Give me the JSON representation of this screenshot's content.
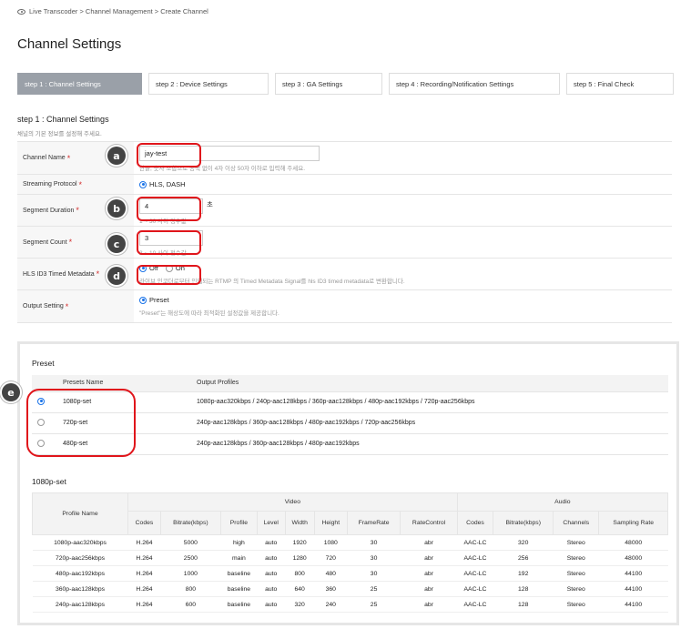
{
  "breadcrumb": "Live Transcoder > Channel Management > Create Channel",
  "page_title": "Channel Settings",
  "steps": [
    {
      "label": "step 1 : Channel Settings",
      "active": true
    },
    {
      "label": "step 2 : Device Settings"
    },
    {
      "label": "step 3 : GA Settings"
    },
    {
      "label": "step 4 : Recording/Notification Settings"
    },
    {
      "label": "step 5 : Final Check"
    }
  ],
  "section": {
    "title": "step 1 : Channel Settings",
    "subtitle": "채널의 기본 정보를 설정해 주세요."
  },
  "form": {
    "channel_name": {
      "label": "Channel Name",
      "value": "jay-test",
      "help": "한글, 숫자 조합으로 공백 없이 4자 이상 50자 이하로 입력해 주세요."
    },
    "streaming_protocol": {
      "label": "Streaming Protocol",
      "option": "HLS, DASH"
    },
    "segment_duration": {
      "label": "Segment Duration",
      "value": "4",
      "unit": "초",
      "help": "1 ~ 30 사이 정수값"
    },
    "segment_count": {
      "label": "Segment Count",
      "value": "3",
      "help": "2 ~ 10 사이 정수값"
    },
    "hls_metadata": {
      "label": "HLS ID3 Timed Metadata",
      "opt_off": "Off",
      "opt_on": "On",
      "help": "라이브 인코더로부터 인입되는 RTMP 의 Timed Metadata Signal를 hls ID3 timed metadata로 변환합니다."
    },
    "output_setting": {
      "label": "Output Setting",
      "option": "Preset",
      "help": "\"Preset\"는 해상도에 따라 최적화된 설정값을 제공합니다."
    }
  },
  "badges": {
    "a": "a",
    "b": "b",
    "c": "c",
    "d": "d",
    "e": "e"
  },
  "preset": {
    "title": "Preset",
    "headers": {
      "name": "Presets Name",
      "profiles": "Output Profiles"
    },
    "rows": [
      {
        "name": "1080p-set",
        "profiles": "1080p-aac320kbps / 240p-aac128kbps / 360p-aac128kbps / 480p-aac192kbps / 720p-aac256kbps",
        "selected": true
      },
      {
        "name": "720p-set",
        "profiles": "240p-aac128kbps / 360p-aac128kbps / 480p-aac192kbps / 720p-aac256kbps"
      },
      {
        "name": "480p-set",
        "profiles": "240p-aac128kbps / 360p-aac128kbps / 480p-aac192kbps"
      }
    ]
  },
  "detail": {
    "title": "1080p-set",
    "group_video": "Video",
    "group_audio": "Audio",
    "headers": {
      "profile_name": "Profile Name",
      "codes": "Codes",
      "bitrate": "Bitrate(kbps)",
      "profile": "Profile",
      "level": "Level",
      "width": "Width",
      "height": "Height",
      "framerate": "FrameRate",
      "ratecontrol": "RateControl",
      "a_codes": "Codes",
      "a_bitrate": "Bitrate(kbps)",
      "channels": "Channels",
      "sampling": "Sampling Rate"
    },
    "rows": [
      [
        "1080p-aac320kbps",
        "H.264",
        "5000",
        "high",
        "auto",
        "1920",
        "1080",
        "30",
        "abr",
        "AAC-LC",
        "320",
        "Stereo",
        "48000"
      ],
      [
        "720p-aac256kbps",
        "H.264",
        "2500",
        "main",
        "auto",
        "1280",
        "720",
        "30",
        "abr",
        "AAC-LC",
        "256",
        "Stereo",
        "48000"
      ],
      [
        "480p-aac192kbps",
        "H.264",
        "1000",
        "baseline",
        "auto",
        "800",
        "480",
        "30",
        "abr",
        "AAC-LC",
        "192",
        "Stereo",
        "44100"
      ],
      [
        "360p-aac128kbps",
        "H.264",
        "800",
        "baseline",
        "auto",
        "640",
        "360",
        "25",
        "abr",
        "AAC-LC",
        "128",
        "Stereo",
        "44100"
      ],
      [
        "240p-aac128kbps",
        "H.264",
        "600",
        "baseline",
        "auto",
        "320",
        "240",
        "25",
        "abr",
        "AAC-LC",
        "128",
        "Stereo",
        "44100"
      ]
    ]
  }
}
